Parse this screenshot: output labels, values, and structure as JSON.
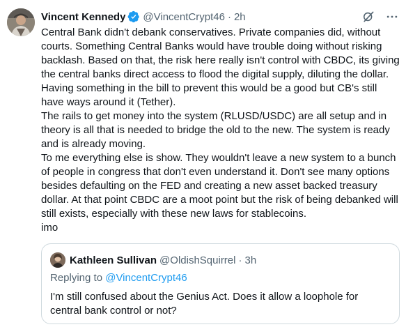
{
  "author": {
    "name": "Vincent Kennedy",
    "handle": "@VincentCrypt46",
    "time": "2h",
    "verified_color": "#1d9bf0"
  },
  "post": {
    "paragraphs": [
      "Central Bank didn't debank conservatives. Private companies did, without courts. Something Central Banks would have trouble doing without risking backlash. Based on that, the risk here really isn't control with CBDC, its giving the central banks direct access to flood the digital supply, diluting the dollar. Having something in the bill to prevent this would be a good but CB's still have ways around it (Tether).",
      "The rails to get money into the system (RLUSD/USDC) are all setup and in theory is all that is needed to bridge the old to the new. The system is ready and is already moving.",
      "To me everything else is show. They wouldn't leave a new system to a bunch of people in congress that don't even understand it. Don't see many options besides defaulting on the FED and creating a new asset backed treasury dollar. At that point CBDC are a moot point but the risk of being debanked will still exists, especially with these new laws for stablecoins.",
      "imo"
    ]
  },
  "quote": {
    "name": "Kathleen Sullivan",
    "handle": "@OldishSquirrel",
    "time": "3h",
    "replying_prefix": "Replying to",
    "replying_to": "@VincentCrypt46",
    "text": "I'm still confused about the Genius Act. Does it allow a loophole for central bank control or not?"
  },
  "icons": {
    "grok": "grok-icon",
    "more": "more-icon"
  },
  "colors": {
    "text": "#0f1419",
    "secondary": "#536471",
    "link": "#1d9bf0",
    "border": "#cfd9de"
  },
  "separator": "·"
}
